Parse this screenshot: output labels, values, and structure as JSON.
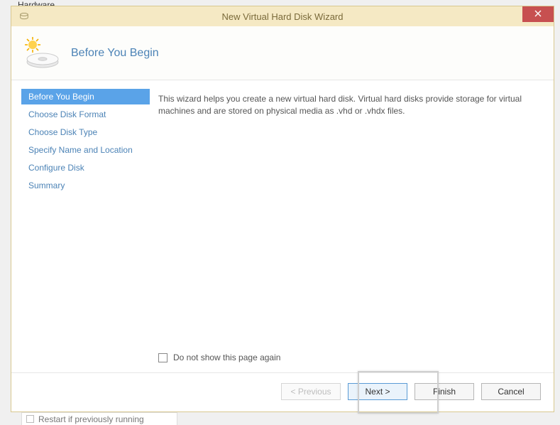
{
  "window": {
    "title": "New Virtual Hard Disk Wizard"
  },
  "header": {
    "title": "Before You Begin"
  },
  "sidebar": {
    "items": [
      {
        "label": "Before You Begin",
        "active": true
      },
      {
        "label": "Choose Disk Format",
        "active": false
      },
      {
        "label": "Choose Disk Type",
        "active": false
      },
      {
        "label": "Specify Name and Location",
        "active": false
      },
      {
        "label": "Configure Disk",
        "active": false
      },
      {
        "label": "Summary",
        "active": false
      }
    ]
  },
  "content": {
    "description": "This wizard helps you create a new virtual hard disk. Virtual hard disks provide storage for virtual machines and are stored on physical media as .vhd or .vhdx files.",
    "checkbox_label": "Do not show this page again"
  },
  "footer": {
    "previous": "< Previous",
    "next": "Next >",
    "finish": "Finish",
    "cancel": "Cancel"
  },
  "background": {
    "top_fragment": "Hardware",
    "bottom_fragment": "Restart if previously running"
  }
}
